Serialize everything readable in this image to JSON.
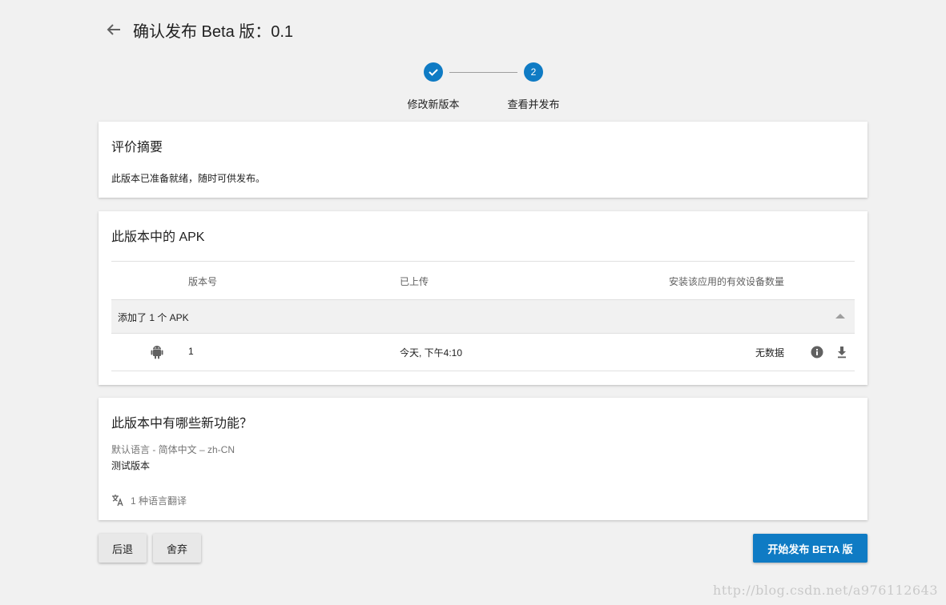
{
  "header": {
    "title": "确认发布 Beta 版：0.1"
  },
  "stepper": {
    "steps": [
      {
        "label": "修改新版本",
        "state": "done"
      },
      {
        "label": "查看并发布",
        "number": "2"
      }
    ],
    "accent": "#0f7bc4"
  },
  "summary": {
    "title": "评价摘要",
    "message": "此版本已准备就绪，随时可供发布。"
  },
  "apk": {
    "title": "此版本中的 APK",
    "columns": [
      "版本号",
      "已上传",
      "安装该应用的有效设备数量"
    ],
    "group_label": "添加了 1 个 APK",
    "rows": [
      {
        "version": "1",
        "uploaded": "今天, 下午4:10",
        "devices": "无数据"
      }
    ]
  },
  "features": {
    "title": "此版本中有哪些新功能？",
    "language": "默认语言 - 简体中文 – zh-CN",
    "notes": "测试版本",
    "translations": "1 种语言翻译"
  },
  "actions": {
    "back": "后退",
    "discard": "舍弃",
    "publish": "开始发布 BETA 版"
  },
  "watermark": "http://blog.csdn.net/a976112643"
}
